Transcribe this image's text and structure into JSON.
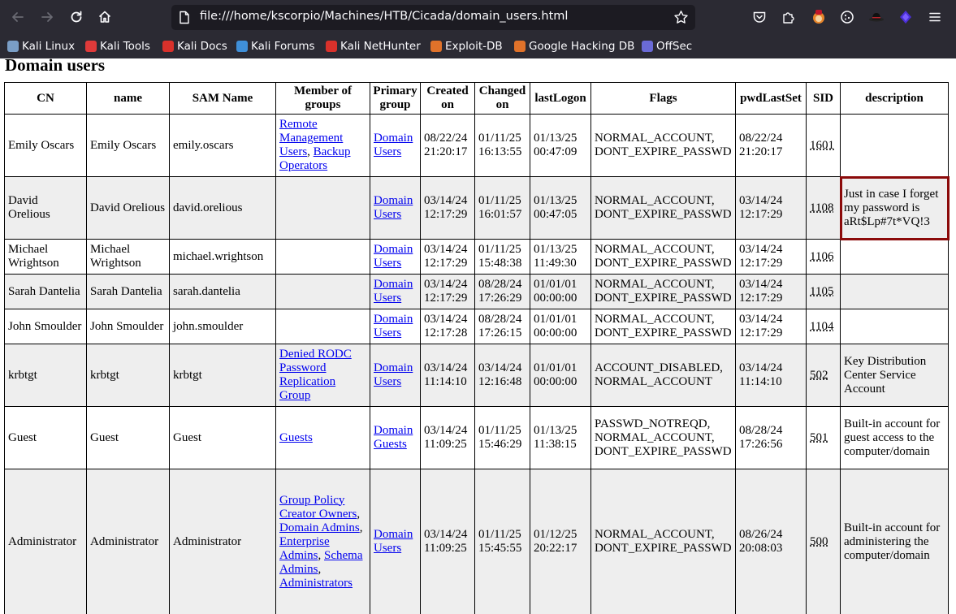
{
  "browser": {
    "url": "file:///home/kscorpio/Machines/HTB/Cicada/domain_users.html",
    "bookmarks": [
      {
        "label": "Kali Linux",
        "icon": "kali-dragon-icon",
        "color": "#7a9ec6"
      },
      {
        "label": "Kali Tools",
        "icon": "kali-tools-icon",
        "color": "#e03a3a"
      },
      {
        "label": "Kali Docs",
        "icon": "kali-docs-icon",
        "color": "#d9312b"
      },
      {
        "label": "Kali Forums",
        "icon": "kali-forums-icon",
        "color": "#3f8fd8"
      },
      {
        "label": "Kali NetHunter",
        "icon": "nethunter-icon",
        "color": "#d9312b"
      },
      {
        "label": "Exploit-DB",
        "icon": "exploit-db-icon",
        "color": "#e0722a"
      },
      {
        "label": "Google Hacking DB",
        "icon": "ghdb-icon",
        "color": "#e0722a"
      },
      {
        "label": "OffSec",
        "icon": "offsec-icon",
        "color": "#6a6ad6"
      }
    ]
  },
  "page": {
    "title": "Domain users",
    "columns": [
      "CN",
      "name",
      "SAM Name",
      "Member of groups",
      "Primary group",
      "Created on",
      "Changed on",
      "lastLogon",
      "Flags",
      "pwdLastSet",
      "SID",
      "description"
    ],
    "rows": [
      {
        "cn": "Emily Oscars",
        "name": "Emily Oscars",
        "sam": "emily.oscars",
        "groups": [
          {
            "text": "Remote Management Users",
            "sep": ", "
          },
          {
            "text": "Backup Operators",
            "sep": ""
          }
        ],
        "primary": "Domain Users",
        "created": "08/22/24 21:20:17",
        "changed": "01/11/25 16:13:55",
        "lastlogon": "01/13/25 00:47:09",
        "flags": "NORMAL_ACCOUNT, DONT_EXPIRE_PASSWD",
        "pwdlastset": "08/22/24 21:20:17",
        "sid": "1601",
        "description": ""
      },
      {
        "cn": "David Orelious",
        "name": "David Orelious",
        "sam": "david.orelious",
        "groups": [],
        "primary": "Domain Users",
        "created": "03/14/24 12:17:29",
        "changed": "01/11/25 16:01:57",
        "lastlogon": "01/13/25 00:47:05",
        "flags": "NORMAL_ACCOUNT, DONT_EXPIRE_PASSWD",
        "pwdlastset": "03/14/24 12:17:29",
        "sid": "1108",
        "description": "Just in case I forget my password is aRt$Lp#7t*VQ!3"
      },
      {
        "cn": "Michael Wrightson",
        "name": "Michael Wrightson",
        "sam": "michael.wrightson",
        "groups": [],
        "primary": "Domain Users",
        "created": "03/14/24 12:17:29",
        "changed": "01/11/25 15:48:38",
        "lastlogon": "01/13/25 11:49:30",
        "flags": "NORMAL_ACCOUNT, DONT_EXPIRE_PASSWD",
        "pwdlastset": "03/14/24 12:17:29",
        "sid": "1106",
        "description": ""
      },
      {
        "cn": "Sarah Dantelia",
        "name": "Sarah Dantelia",
        "sam": "sarah.dantelia",
        "groups": [],
        "primary": "Domain Users",
        "created": "03/14/24 12:17:29",
        "changed": "08/28/24 17:26:29",
        "lastlogon": "01/01/01 00:00:00",
        "flags": "NORMAL_ACCOUNT, DONT_EXPIRE_PASSWD",
        "pwdlastset": "03/14/24 12:17:29",
        "sid": "1105",
        "description": ""
      },
      {
        "cn": "John Smoulder",
        "name": "John Smoulder",
        "sam": "john.smoulder",
        "groups": [],
        "primary": "Domain Users",
        "created": "03/14/24 12:17:28",
        "changed": "08/28/24 17:26:15",
        "lastlogon": "01/01/01 00:00:00",
        "flags": "NORMAL_ACCOUNT, DONT_EXPIRE_PASSWD",
        "pwdlastset": "03/14/24 12:17:29",
        "sid": "1104",
        "description": ""
      },
      {
        "cn": "krbtgt",
        "name": "krbtgt",
        "sam": "krbtgt",
        "groups": [
          {
            "text": "Denied RODC Password Replication Group",
            "sep": ""
          }
        ],
        "primary": "Domain Users",
        "created": "03/14/24 11:14:10",
        "changed": "03/14/24 12:16:48",
        "lastlogon": "01/01/01 00:00:00",
        "flags": "ACCOUNT_DISABLED, NORMAL_ACCOUNT",
        "pwdlastset": "03/14/24 11:14:10",
        "sid": "502",
        "description": "Key Distribution Center Service Account"
      },
      {
        "cn": "Guest",
        "name": "Guest",
        "sam": "Guest",
        "groups": [
          {
            "text": "Guests",
            "sep": ""
          }
        ],
        "primary": "Domain Guests",
        "created": "03/14/24 11:09:25",
        "changed": "01/11/25 15:46:29",
        "lastlogon": "01/13/25 11:38:15",
        "flags": "PASSWD_NOTREQD, NORMAL_ACCOUNT, DONT_EXPIRE_PASSWD",
        "pwdlastset": "08/28/24 17:26:56",
        "sid": "501",
        "description": "Built-in account for guest access to the computer/domain"
      },
      {
        "cn": "Administrator",
        "name": "Administrator",
        "sam": "Administrator",
        "groups": [
          {
            "text": "Group Policy Creator Owners",
            "sep": ", "
          },
          {
            "text": "Domain Admins",
            "sep": ", "
          },
          {
            "text": "Enterprise Admins",
            "sep": ", "
          },
          {
            "text": "Schema Admins",
            "sep": ", "
          },
          {
            "text": "Administrators",
            "sep": ""
          }
        ],
        "primary": "Domain Users",
        "created": "03/14/24 11:09:25",
        "changed": "01/11/25 15:45:55",
        "lastlogon": "01/12/25 20:22:17",
        "flags": "NORMAL_ACCOUNT, DONT_EXPIRE_PASSWD",
        "pwdlastset": "08/26/24 20:08:03",
        "sid": "500",
        "description": "Built-in account for administering the computer/domain"
      }
    ]
  },
  "highlight": {
    "row": 1,
    "column": "description",
    "color": "#8b0a0a"
  }
}
